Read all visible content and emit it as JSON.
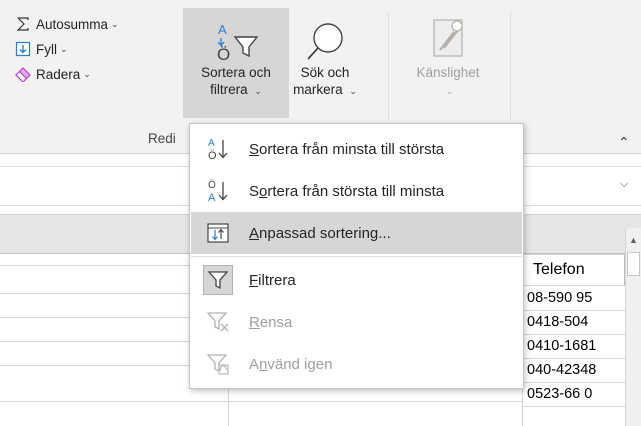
{
  "ribbon": {
    "group_label": "Redi",
    "small_buttons": [
      {
        "label": "Autosumma",
        "icon": "sigma-icon"
      },
      {
        "label": "Fyll",
        "icon": "fill-down-icon"
      },
      {
        "label": "Radera",
        "icon": "eraser-icon"
      }
    ],
    "sort_filter": {
      "line1": "Sortera och",
      "line2": "filtrera"
    },
    "find_select": {
      "line1": "Sök och",
      "line2": "markera"
    },
    "sensitivity": {
      "label": "Känslighet"
    }
  },
  "menu": {
    "items": [
      {
        "pre": "",
        "accel": "S",
        "post": "ortera från minsta till största",
        "icon": "sort-asc-icon",
        "state": "normal"
      },
      {
        "pre": "S",
        "accel": "o",
        "post": "rtera från största till minsta",
        "icon": "sort-desc-icon",
        "state": "normal"
      },
      {
        "pre": "",
        "accel": "A",
        "post": "npassad sortering...",
        "icon": "custom-sort-icon",
        "state": "hover"
      },
      {
        "pre": "",
        "accel": "F",
        "post": "iltrera",
        "icon": "filter-icon",
        "state": "normal"
      },
      {
        "pre": "",
        "accel": "R",
        "post": "ensa",
        "icon": "clear-filter-icon",
        "state": "disabled"
      },
      {
        "pre": "A",
        "accel": "n",
        "post": "vänd igen",
        "icon": "reapply-filter-icon",
        "state": "disabled"
      }
    ]
  },
  "sheet": {
    "header": "Telefon",
    "cells": [
      "08-590 95",
      "0418-504",
      "0410-1681",
      "040-42348",
      "0523-66 0"
    ]
  },
  "colors": {
    "ribbon_bg": "#f3f2f1",
    "selected_bg": "#d7d6d5",
    "menu_hover": "#d6d6d6",
    "accent_blue": "#2b7cd3",
    "eraser_purple": "#b146c2",
    "disabled_text": "#a19f9d"
  }
}
